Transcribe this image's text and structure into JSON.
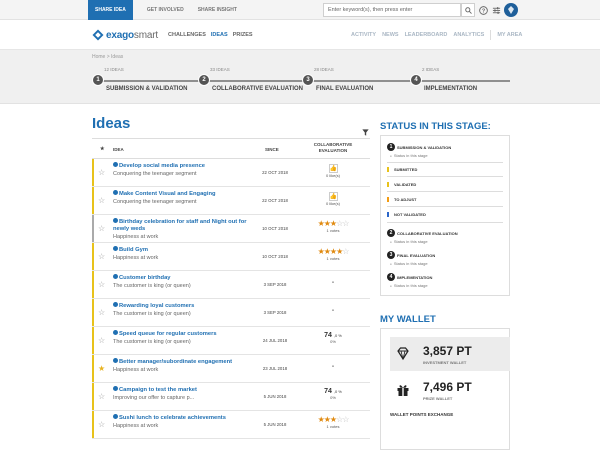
{
  "topbar": {
    "share_idea": "SHARE IDEA",
    "links": [
      "GET INVOLVED",
      "SHARE INSIGHT"
    ],
    "search_placeholder": "Enter keyword(s), then press enter"
  },
  "logo": {
    "word_bold": "exago",
    "word_light": "smart"
  },
  "nav": {
    "main": [
      "CHALLENGES",
      "IDEAS",
      "PRIZES"
    ],
    "active": "IDEAS",
    "right": [
      "ACTIVITY",
      "NEWS",
      "LEADERBOARD",
      "ANALYTICS"
    ],
    "my_area": "MY AREA"
  },
  "breadcrumb": "Home  >  Ideas",
  "stages": [
    {
      "num": "1",
      "count": "12 IDEAS",
      "label": "SUBMISSION & VALIDATION"
    },
    {
      "num": "2",
      "count": "33 IDEAS",
      "label": "COLLABORATIVE EVALUATION"
    },
    {
      "num": "3",
      "count": "28 IDEAS",
      "label": "FINAL EVALUATION"
    },
    {
      "num": "4",
      "count": "2 IDEAS",
      "label": "IMPLEMENTATION"
    }
  ],
  "ideas": {
    "title": "Ideas",
    "headers": {
      "star": "★",
      "idea": "IDEA",
      "since": "SINCE",
      "collab": "COLLABORATIVE EVALUATION"
    },
    "rows": [
      {
        "title": "Develop social media presence",
        "sub": "Conquering the teenager segment",
        "since": "22 OCT 2018",
        "kind": "like",
        "likes": "0 like(s)",
        "bar": "#e8c21a",
        "fav": false
      },
      {
        "title": "Make Content Visual and Engaging",
        "sub": "Conquering the teenager segment",
        "since": "22 OCT 2018",
        "kind": "like",
        "likes": "0 like(s)",
        "bar": "#e8c21a",
        "fav": false
      },
      {
        "title": "Birthday celebration for staff and Night out for newly weds",
        "sub": "Happiness at work",
        "since": "10 OCT 2018",
        "kind": "stars",
        "stars": 3,
        "votes": "1 votes",
        "bar": "#aaaaaa",
        "fav": false
      },
      {
        "title": "Build Gym",
        "sub": "Happiness at work",
        "since": "10 OCT 2018",
        "kind": "stars",
        "stars": 4,
        "votes": "1 votes",
        "bar": "#e8c21a",
        "fav": false
      },
      {
        "title": "Customer birthday",
        "sub": "The customer is king (or queen)",
        "since": "3 SEP 2018",
        "kind": "dash",
        "bar": "#e8c21a",
        "fav": false
      },
      {
        "title": "Rewarding loyal customers",
        "sub": "The customer is king (or queen)",
        "since": "3 SEP 2018",
        "kind": "dash",
        "bar": "#e8c21a",
        "fav": false
      },
      {
        "title": "Speed queue for regular customers",
        "sub": "The customer is king (or queen)",
        "since": "24 JUL 2018",
        "kind": "pct",
        "pct": "74",
        "pct_sub": "0%",
        "bar": "#e8c21a",
        "fav": false
      },
      {
        "title": "Better manager/subordinate engagement",
        "sub": "Happiness at work",
        "since": "23 JUL 2018",
        "kind": "dash",
        "bar": "#e8c21a",
        "fav": true
      },
      {
        "title": "Campaign to test the market",
        "sub": "Improving our offer to capture p...",
        "since": "5 JUN 2018",
        "kind": "pct",
        "pct": "74",
        "pct_sub": "0%",
        "bar": "#e8c21a",
        "fav": false
      },
      {
        "title": "Sushi lunch to celebrate achievements",
        "sub": "Happiness at work",
        "since": "5 JUN 2018",
        "kind": "stars",
        "stars": 3,
        "votes": "1 votes",
        "bar": "#e8c21a",
        "fav": false
      }
    ]
  },
  "status": {
    "title": "STATUS IN THIS STAGE:",
    "s1": "SUBMISSION & VALIDATION",
    "s1_sub": "Status in this stage",
    "colors": [
      {
        "label": "SUBMITTED",
        "color": "#e8c21a"
      },
      {
        "label": "VALIDATED",
        "color": "#e8c21a"
      },
      {
        "label": "TO ADJUST",
        "color": "#f39c12"
      },
      {
        "label": "NOT VALIDATED",
        "color": "#2c66c8"
      }
    ],
    "s2": "COLLABORATIVE EVALUATION",
    "s2_sub": "Status in this stage",
    "s3": "FINAL EVALUATION",
    "s3_sub": "Status in this stage",
    "s4": "IMPLEMENTATION",
    "s4_sub": "Status in this stage"
  },
  "wallet": {
    "title": "MY WALLET",
    "investment_amount": "3,857 PT",
    "investment_label": "INVESTMENT WALLET",
    "prize_amount": "7,496 PT",
    "prize_label": "PRIZE WALLET",
    "exchange": "WALLET POINTS EXCHANGE"
  }
}
